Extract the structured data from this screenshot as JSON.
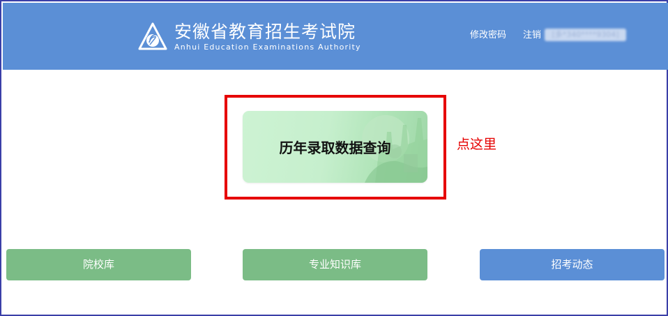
{
  "header": {
    "logo_cn": "安徽省教育招生考试院",
    "logo_en": "Anhui Education Examinations Authority",
    "change_password": "修改密码",
    "logout": "注销",
    "username_masked": "[多*340****9304]",
    "bg_color": "#5b8fd6",
    "logo_icon": "aeea-logo-icon"
  },
  "main": {
    "query_card_title": "历年录取数据查询",
    "hint": "点这里",
    "highlight_color": "#e60000"
  },
  "bottom_buttons": [
    {
      "label": "院校库",
      "color": "#7bbc86"
    },
    {
      "label": "专业知识库",
      "color": "#7bbc86"
    },
    {
      "label": "招考动态",
      "color": "#5b8fd6"
    }
  ]
}
